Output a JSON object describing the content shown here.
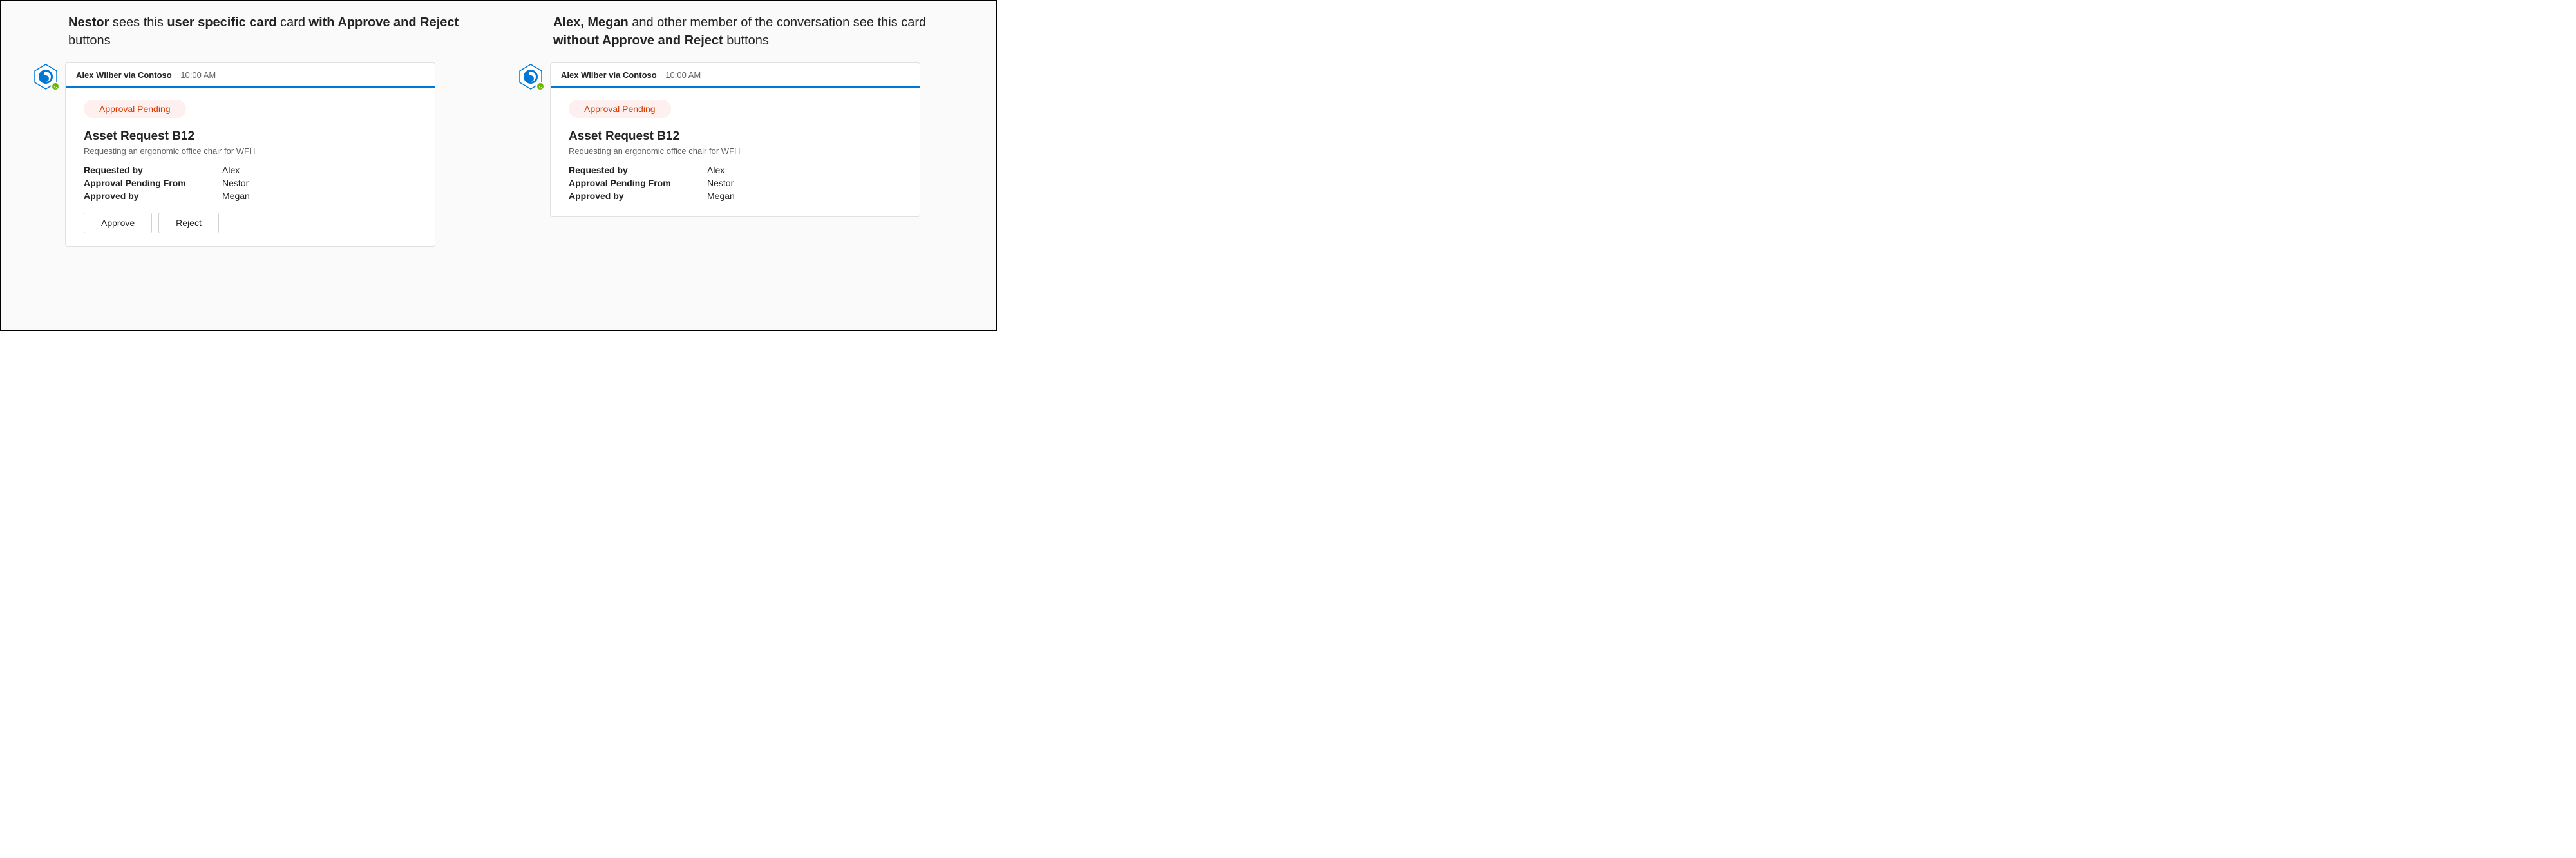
{
  "captions": {
    "left_html": "<strong>Nestor</strong> sees this <strong>user specific card</strong> card <strong>with Approve and Reject</strong> buttons",
    "right_html": "<strong>Alex, Megan</strong> and other member of the conversation see this card <strong>without Approve and Reject</strong> buttons"
  },
  "card": {
    "sender": "Alex Wilber via Contoso",
    "timestamp": "10:00 AM",
    "status_label": "Approval Pending",
    "title": "Asset Request B12",
    "subtitle": "Requesting an ergonomic office chair for WFH",
    "fields": {
      "requested_by_label": "Requested by",
      "requested_by_value": "Alex",
      "approval_pending_from_label": "Approval Pending From",
      "approval_pending_from_value": "Nestor",
      "approved_by_label": "Approved by",
      "approved_by_value": "Megan"
    },
    "actions": {
      "approve_label": "Approve",
      "reject_label": "Reject"
    }
  },
  "colors": {
    "accent": "#0078d4",
    "status_bg": "#fdf0ef",
    "status_fg": "#d83b01",
    "presence": "#6bb700"
  }
}
